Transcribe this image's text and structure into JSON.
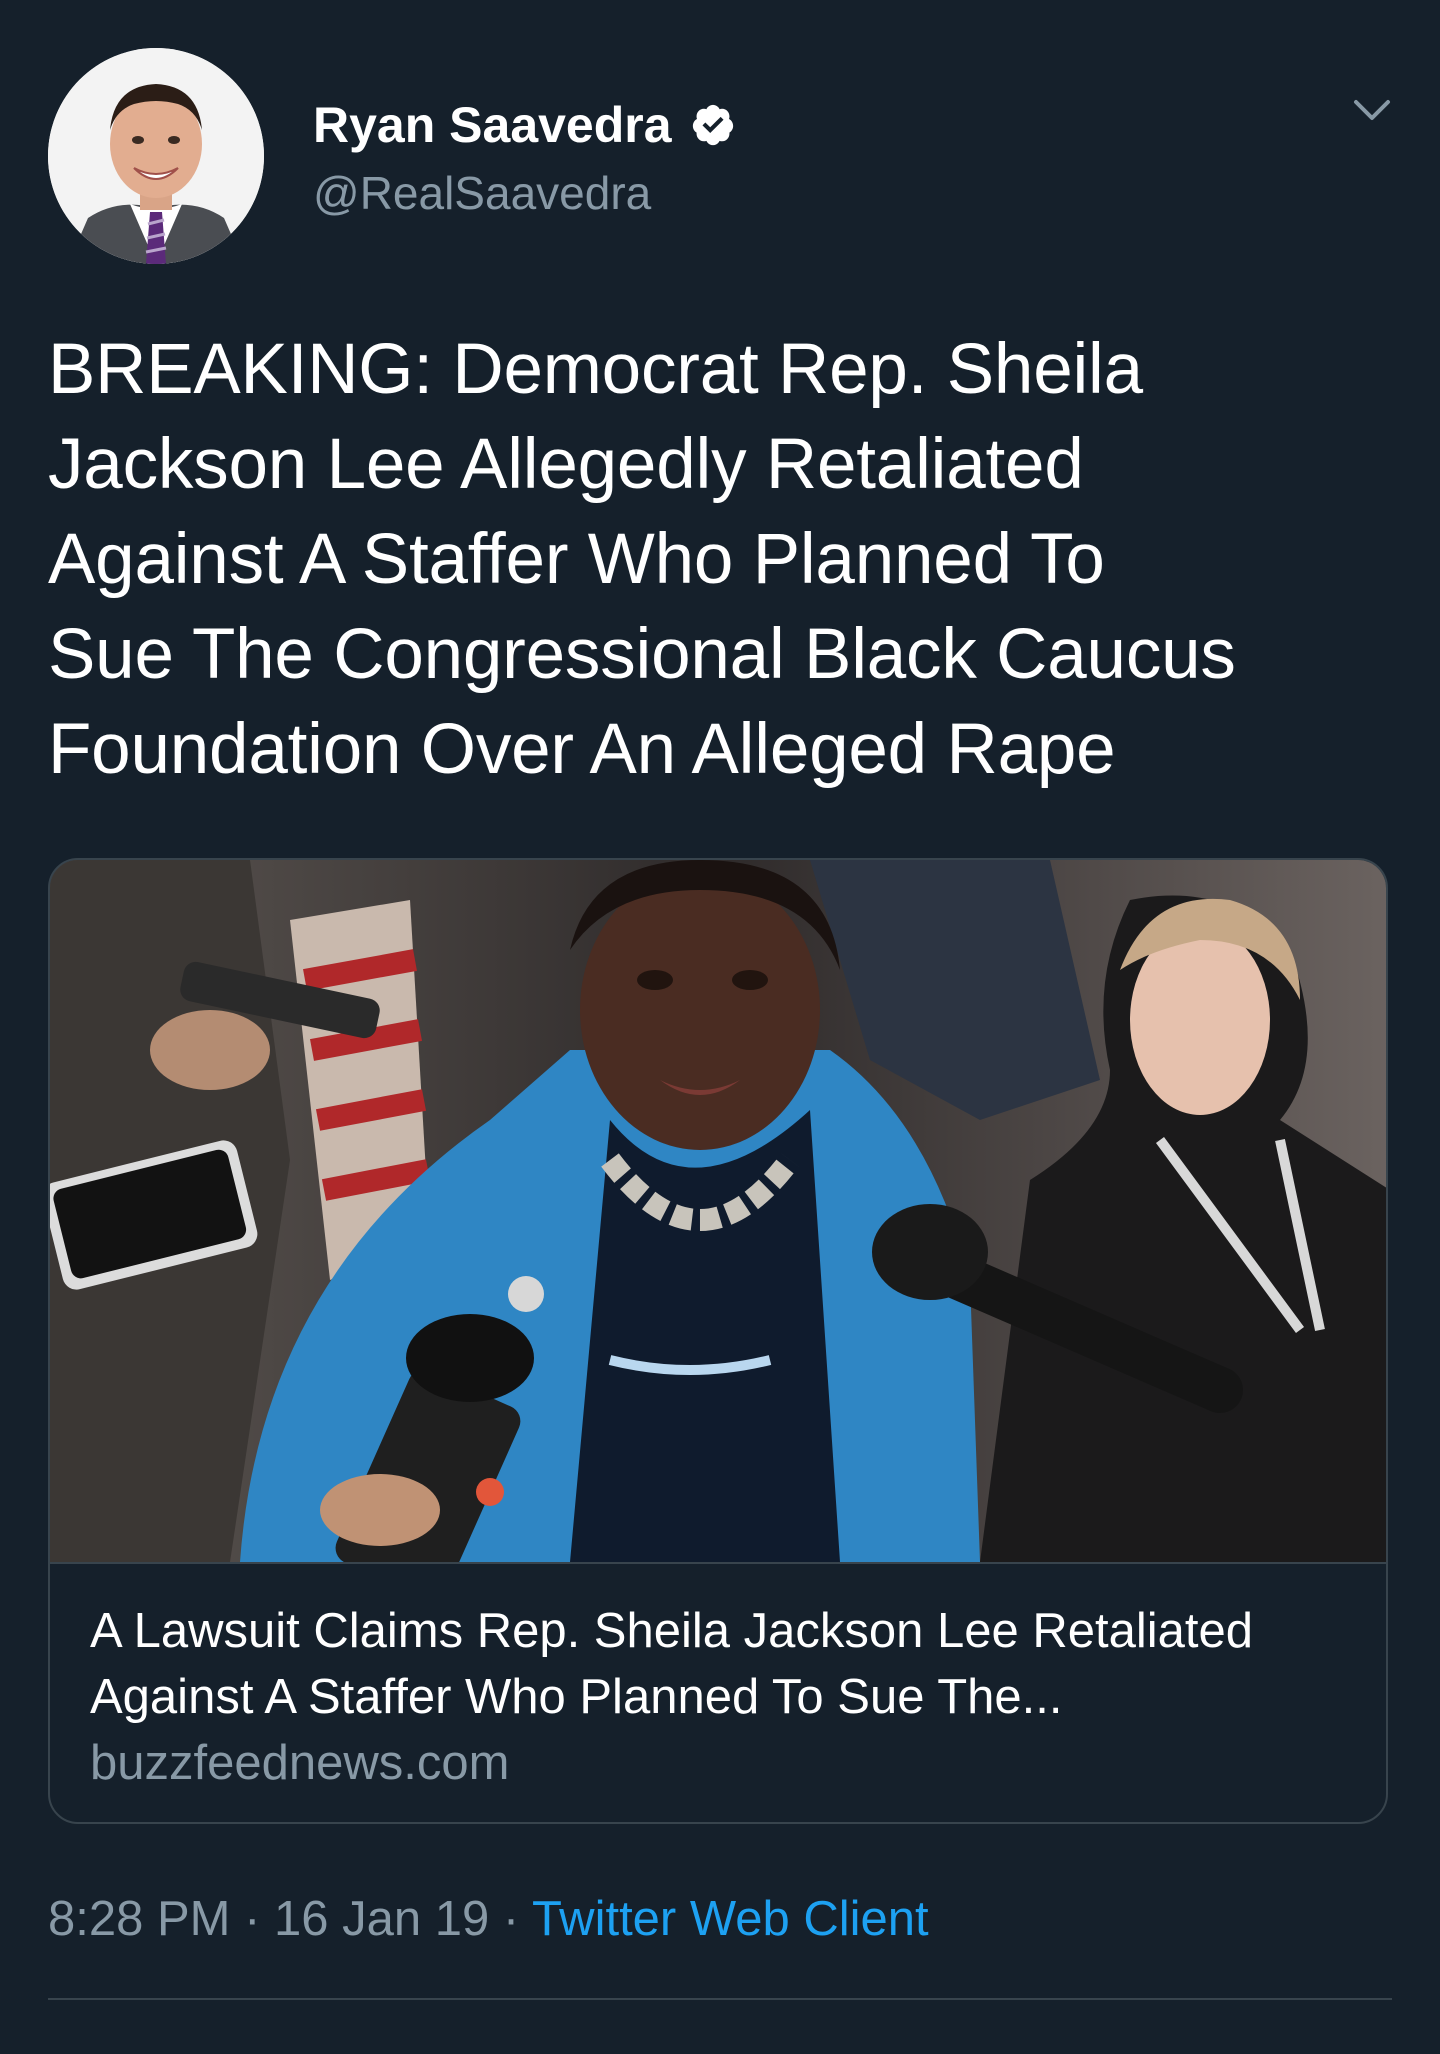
{
  "user": {
    "display_name": "Ryan Saavedra",
    "handle": "@RealSaavedra",
    "verified": true,
    "verified_icon": "verified-badge-icon",
    "avatar_icon": "avatar-photo"
  },
  "menu": {
    "icon": "chevron-down-icon"
  },
  "tweet": {
    "lines": [
      "BREAKING: Democrat Rep. Sheila",
      "Jackson Lee Allegedly Retaliated",
      "Against A Staffer Who Planned To",
      "Sue The Congressional Black Caucus",
      "Foundation Over An Alleged Rape"
    ]
  },
  "card": {
    "image_icon": "news-photo",
    "title_lines": [
      "A Lawsuit Claims Rep. Sheila Jackson Lee Retaliated",
      "Against A Staffer Who Planned To Sue The..."
    ],
    "domain": "buzzfeednews.com"
  },
  "meta": {
    "time": "8:28 PM",
    "separator": " · ",
    "date": "16 Jan 19",
    "client": "Twitter Web Client"
  },
  "colors": {
    "background": "#15202b",
    "text": "#ffffff",
    "secondary_text": "#8899a6",
    "accent": "#1da1f2",
    "border": "#38444d"
  }
}
